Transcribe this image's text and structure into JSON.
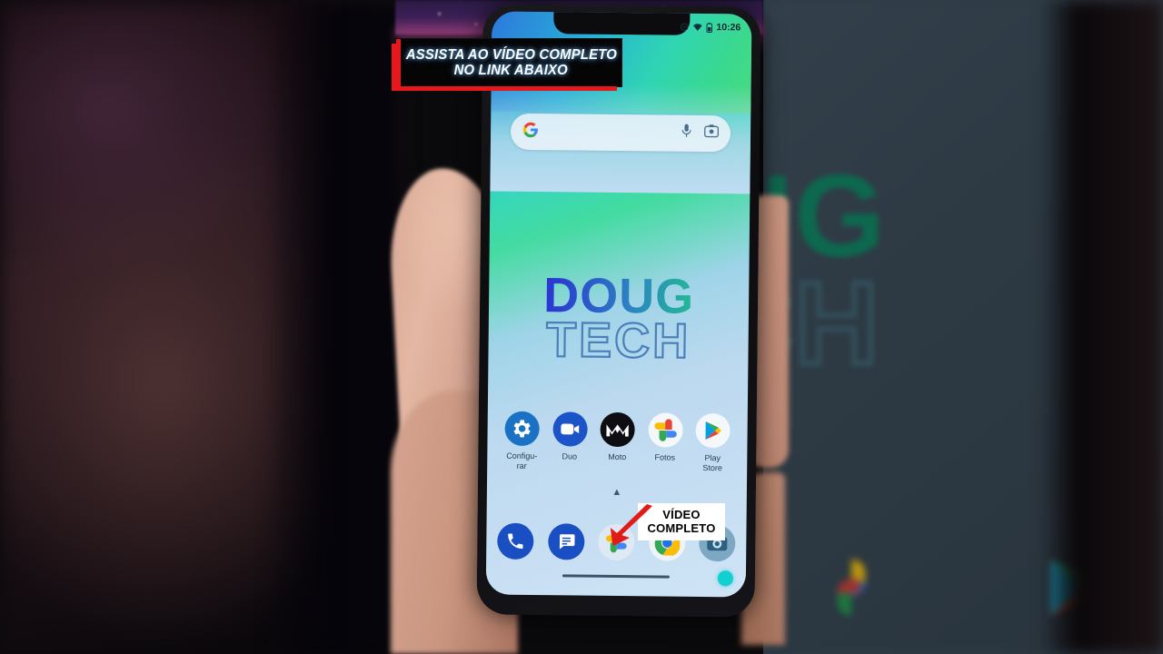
{
  "overlay": {
    "banner": {
      "line1": "ASSISTA AO VÍDEO COMPLETO",
      "line2": "NO LINK ABAIXO",
      "bg_color": "#050505",
      "accent_color": "#e8171c",
      "text_color": "#ffffff"
    },
    "callout": {
      "line1": "VÍDEO",
      "line2": "COMPLETO",
      "bg_color": "#ffffff",
      "text_color": "#000000",
      "arrow_color": "#e01b18",
      "arrow_icon": "arrow-down-left-icon"
    }
  },
  "phone": {
    "statusbar": {
      "dnd_icon": "do-not-disturb-icon",
      "wifi_icon": "wifi-icon",
      "battery_icon": "battery-icon",
      "time": "10:26"
    },
    "search": {
      "google_icon": "google-g-icon",
      "mic_icon": "microphone-icon",
      "lens_icon": "google-lens-icon",
      "placeholder": ""
    },
    "wallpaper": {
      "line1": "DOUG",
      "line2": "TECH",
      "gradient_start": "#2a16d8",
      "gradient_end": "#1fc58c",
      "outline_color": "#4a7fb8"
    },
    "apps": [
      {
        "label": "Configu-\nrar",
        "icon": "settings-gear-icon"
      },
      {
        "label": "Duo",
        "icon": "google-duo-icon"
      },
      {
        "label": "Moto",
        "icon": "motorola-icon"
      },
      {
        "label": "Fotos",
        "icon": "google-photos-icon"
      },
      {
        "label": "Play\nStore",
        "icon": "google-play-store-icon"
      }
    ],
    "app_drawer_chevron": "chevron-up-icon",
    "dock": [
      {
        "icon": "phone-dialer-icon"
      },
      {
        "icon": "messages-icon"
      },
      {
        "icon": "google-photos-icon"
      },
      {
        "icon": "chrome-icon"
      },
      {
        "icon": "camera-icon"
      }
    ],
    "gesture_bar": "gesture-navigation-bar",
    "recording_indicator": "screen-recording-dot"
  },
  "background": {
    "left_description": "blurred-dark-scene",
    "right_description": "blurred-zoomed-wallpaper",
    "right_wallpaper_line1": "UG",
    "right_wallpaper_line2": "CH",
    "right_bg_color": "#2f3b45"
  }
}
